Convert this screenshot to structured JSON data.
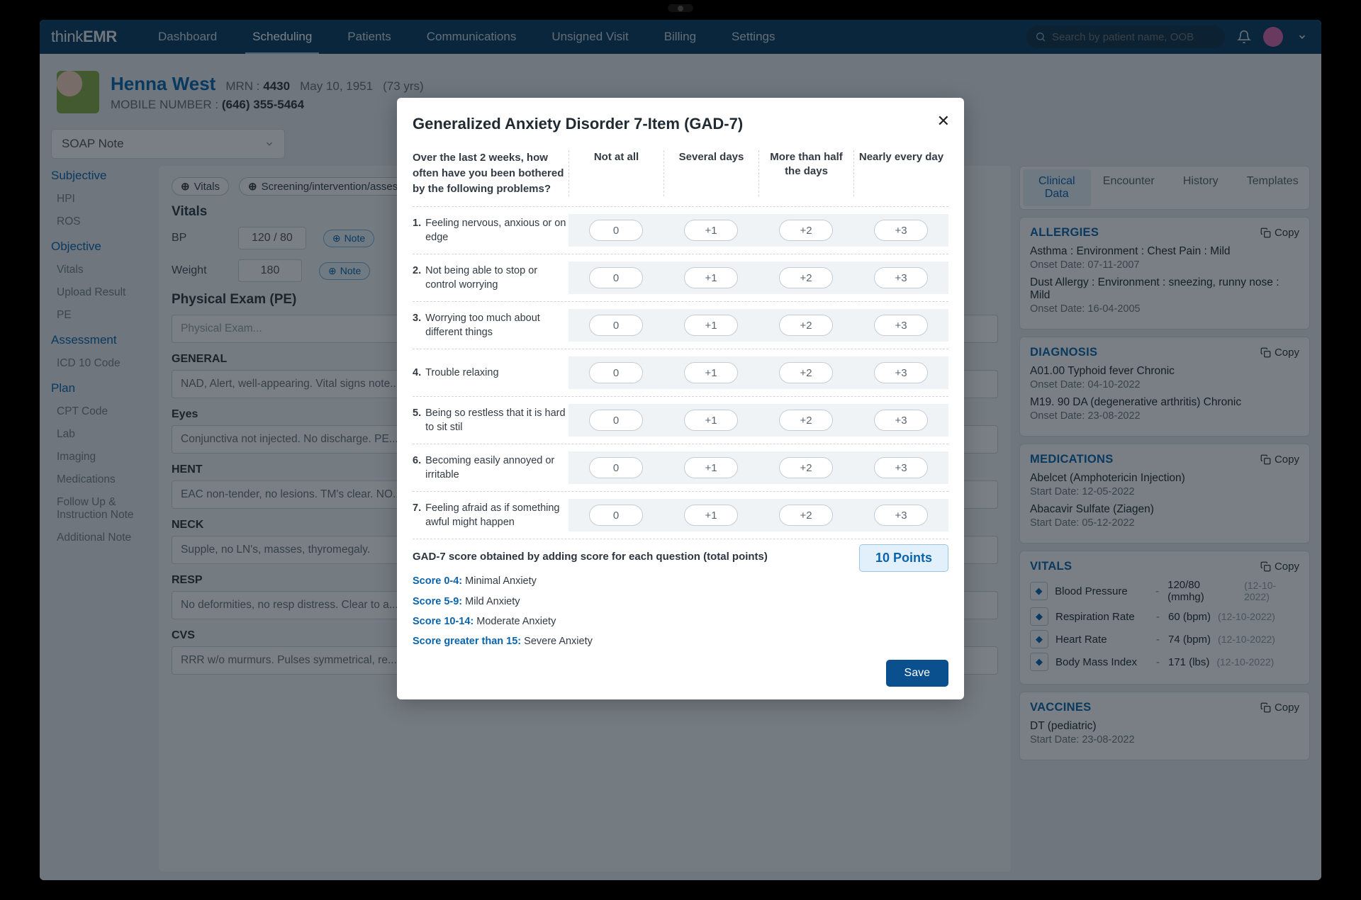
{
  "brand": {
    "thin": "think",
    "bold": "EMR"
  },
  "nav": {
    "items": [
      "Dashboard",
      "Scheduling",
      "Patients",
      "Communications",
      "Unsigned Visit",
      "Billing",
      "Settings"
    ],
    "active": "Scheduling",
    "search_placeholder": "Search by patient name, OOB"
  },
  "patient": {
    "name": "Henna West",
    "mrn_label": "MRN :",
    "mrn": "4430",
    "dob": "May 10, 1951",
    "age": "(73 yrs)",
    "mobile_label": "MOBILE NUMBER :",
    "mobile": "(646) 355-5464"
  },
  "soap_dropdown": "SOAP Note",
  "left_nav": {
    "groups": [
      {
        "head": "Subjective",
        "items": [
          "HPI",
          "ROS"
        ]
      },
      {
        "head": "Objective",
        "items": [
          "Vitals",
          "Upload Result",
          "PE"
        ]
      },
      {
        "head": "Assessment",
        "items": [
          "ICD 10 Code"
        ]
      },
      {
        "head": "Plan",
        "items": [
          "CPT Code",
          "Lab",
          "Imaging",
          "Medications",
          "Follow Up & Instruction Note",
          "Additional Note"
        ]
      }
    ]
  },
  "mid": {
    "chips": [
      "Vitals",
      "Screening/intervention/assess..."
    ],
    "vitals_title": "Vitals",
    "bp_label": "BP",
    "bp_value": "120 / 80",
    "weight_label": "Weight",
    "weight_value": "180",
    "note_label": "Note",
    "pe_title": "Physical Exam (PE)",
    "pe_placeholder": "Physical Exam...",
    "sections": [
      {
        "h": "GENERAL",
        "v": "NAD, Alert, well-appearing. Vital signs note..."
      },
      {
        "h": "Eyes",
        "v": "Conjunctiva not injected. No discharge. PE..."
      },
      {
        "h": "HENT",
        "v": "EAC non-tender, no lesions. TM's clear. NO..."
      },
      {
        "h": "NECK",
        "v": "Supple, no LN's, masses, thyromegaly."
      },
      {
        "h": "RESP",
        "v": "No deformities, no resp distress. Clear to a..."
      },
      {
        "h": "CVS",
        "v": "RRR w/o murmurs. Pulses symmetrical, re..."
      }
    ]
  },
  "right": {
    "tabs": [
      "Clinical Data",
      "Encounter",
      "History",
      "Templates"
    ],
    "active_tab": "Clinical Data",
    "copy_label": "Copy",
    "allergies": {
      "title": "ALLERGIES",
      "items": [
        {
          "main": "Asthma : Environment : Chest Pain : Mild",
          "sub": "Onset Date: 07-11-2007"
        },
        {
          "main": "Dust Allergy : Environment : sneezing, runny nose : Mild",
          "sub": "Onset Date: 16-04-2005"
        }
      ]
    },
    "diagnosis": {
      "title": "DIAGNOSIS",
      "items": [
        {
          "main": "A01.00   Typhoid fever   Chronic",
          "sub": "Onset Date: 04-10-2022"
        },
        {
          "main": "M19. 90   DA (degenerative arthritis)   Chronic",
          "sub": "Onset Date: 23-08-2022"
        }
      ]
    },
    "medications": {
      "title": "MEDICATIONS",
      "items": [
        {
          "main": "Abelcet (Amphotericin Injection)",
          "sub": "Start Date: 12-05-2022"
        },
        {
          "main": "Abacavir Sulfate (Ziagen)",
          "sub": "Start Date: 05-12-2022"
        }
      ]
    },
    "vitals": {
      "title": "VITALS",
      "rows": [
        {
          "label": "Blood Pressure",
          "value": "120/80 (mmhg)",
          "date": "(12-10-2022)"
        },
        {
          "label": "Respiration Rate",
          "value": "60 (bpm)",
          "date": "(12-10-2022)"
        },
        {
          "label": "Heart Rate",
          "value": "74 (bpm)",
          "date": "(12-10-2022)"
        },
        {
          "label": "Body Mass Index",
          "value": "171 (lbs)",
          "date": "(12-10-2022)"
        }
      ]
    },
    "vaccines": {
      "title": "VACCINES",
      "items": [
        {
          "main": "DT (pediatric)",
          "sub": "Start Date: 23-08-2022"
        }
      ]
    }
  },
  "modal": {
    "title": "Generalized Anxiety Disorder 7-Item (GAD-7)",
    "prompt": "Over the last 2 weeks, how often have you been bothered by the following problems?",
    "columns": [
      "Not at all",
      "Several days",
      "More than half the days",
      "Nearly every day"
    ],
    "options": [
      "0",
      "+1",
      "+2",
      "+3"
    ],
    "questions": [
      "Feeling nervous, anxious or on edge",
      "Not being able to stop or control worrying",
      "Worrying too much about different things",
      "Trouble relaxing",
      "Being so restless that it is hard to sit stil",
      "Becoming easily annoyed or irritable",
      "Feeling afraid as if something awful might happen"
    ],
    "score_title": "GAD-7 score obtained by adding score for each question (total points)",
    "points": "10 Points",
    "legend": [
      {
        "b": "Score 0-4:",
        "t": " Minimal Anxiety"
      },
      {
        "b": "Score 5-9:",
        "t": " Mild Anxiety"
      },
      {
        "b": "Score 10-14:",
        "t": " Moderate Anxiety"
      },
      {
        "b": "Score greater than 15:",
        "t": " Severe Anxiety"
      }
    ],
    "save": "Save"
  }
}
